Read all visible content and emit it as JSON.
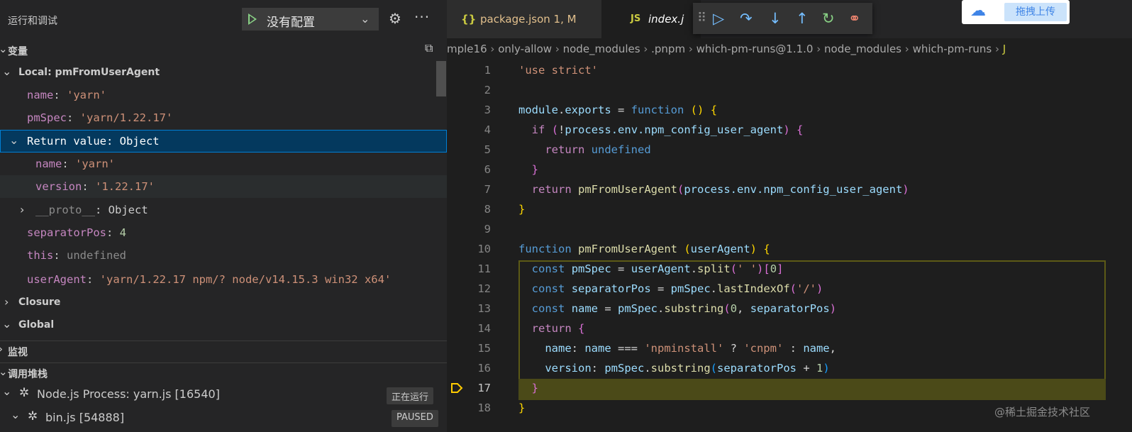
{
  "run_view": {
    "title": "运行和调试",
    "config": "没有配置"
  },
  "variables": {
    "section_label": "变量",
    "local_scope": "Local: pmFromUserAgent",
    "name_key": "name",
    "name_val": "'yarn'",
    "pmspec_key": "pmSpec",
    "pmspec_val": "'yarn/1.22.17'",
    "return_label": "Return value: Object",
    "ret_name_key": "name",
    "ret_name_val": "'yarn'",
    "ret_version_key": "version",
    "ret_version_val": "'1.22.17'",
    "proto_key": "__proto__",
    "proto_val": "Object",
    "separator_key": "separatorPos",
    "separator_val": "4",
    "this_key": "this",
    "this_val": "undefined",
    "useragent_key": "userAgent",
    "useragent_val": "'yarn/1.22.17 npm/? node/v14.15.3 win32 x64'",
    "closure": "Closure",
    "global": "Global"
  },
  "watch": {
    "label": "监视"
  },
  "callstack": {
    "label": "调用堆栈",
    "process": "Node.js Process: yarn.js [16540]",
    "process_status": "正在运行",
    "bin": "bin.js [54888]",
    "bin_status": "PAUSED"
  },
  "tabs": [
    {
      "icon": "{}",
      "label": "package.json 1, M"
    },
    {
      "icon": "JS",
      "label": "index.j"
    }
  ],
  "upload_label": "拖拽上传",
  "breadcrumb": [
    "mple16",
    "only-allow",
    "node_modules",
    ".pnpm",
    "which-pm-runs@1.1.0",
    "node_modules",
    "which-pm-runs",
    "J"
  ],
  "line_numbers": [
    "1",
    "2",
    "3",
    "4",
    "5",
    "6",
    "7",
    "8",
    "9",
    "10",
    "11",
    "12",
    "13",
    "14",
    "15",
    "16",
    "17",
    "18"
  ],
  "code": {
    "l1": "'use strict'",
    "l3_module": "module",
    "l3_exports": "exports",
    "l3_function": "function",
    "l4_if": "if",
    "l4_cond": "process.env.npm_config_user_agent",
    "l5_return": "return",
    "l5_undefined": "undefined",
    "l7_return": "return",
    "l7_fn": "pmFromUserAgent",
    "l7_arg": "process.env.npm_config_user_agent",
    "l10_function": "function",
    "l10_name": "pmFromUserAgent",
    "l10_param": "userAgent",
    "l11_const": "const",
    "l11_var": "pmSpec",
    "l11_obj": "userAgent",
    "l11_fn": "split",
    "l11_str": "' '",
    "l11_idx": "0",
    "l12_const": "const",
    "l12_var": "separatorPos",
    "l12_obj": "pmSpec",
    "l12_fn": "lastIndexOf",
    "l12_str": "'/'",
    "l13_const": "const",
    "l13_var": "name",
    "l13_obj": "pmSpec",
    "l13_fn": "substring",
    "l13_n": "0",
    "l13_arg": "separatorPos",
    "l14_return": "return",
    "l15_key": "name",
    "l15_var": "name",
    "l15_str1": "'npminstall'",
    "l15_str2": "'cnpm'",
    "l15_var2": "name",
    "l16_key": "version",
    "l16_obj": "pmSpec",
    "l16_fn": "substring",
    "l16_arg": "separatorPos",
    "l16_n": "1"
  },
  "watermark": "@稀土掘金技术社区"
}
